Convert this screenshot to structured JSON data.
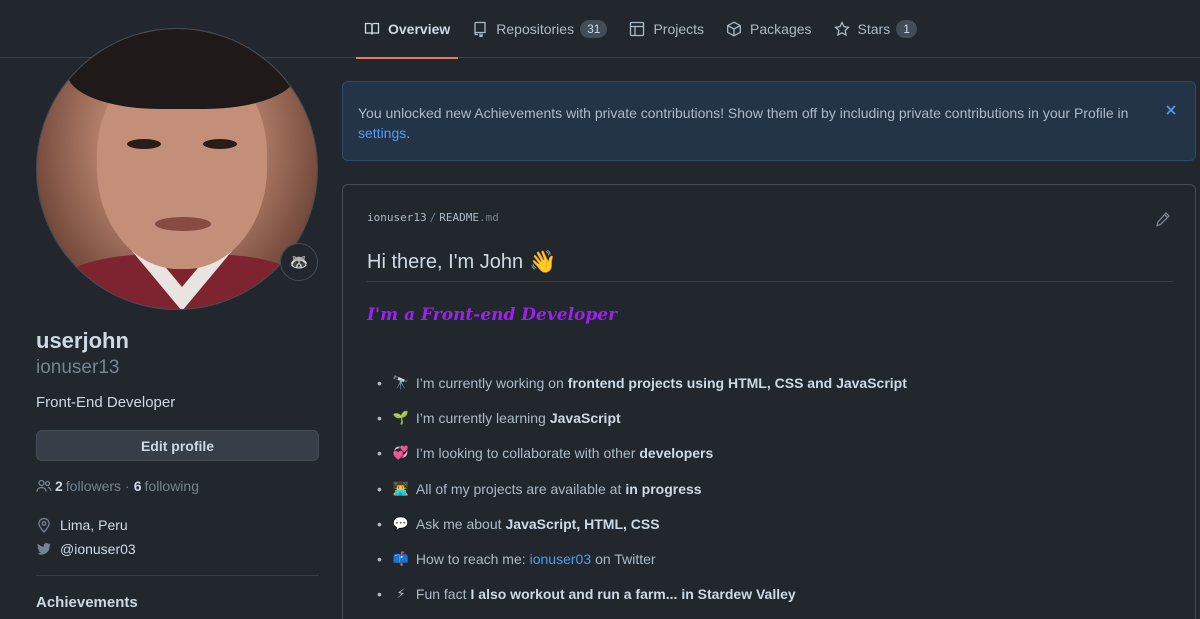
{
  "tabs": [
    {
      "label": "Overview",
      "icon": "book-icon",
      "active": true
    },
    {
      "label": "Repositories",
      "icon": "repo-icon",
      "count": "31"
    },
    {
      "label": "Projects",
      "icon": "table-icon"
    },
    {
      "label": "Packages",
      "icon": "package-icon"
    },
    {
      "label": "Stars",
      "icon": "star-icon",
      "count": "1"
    }
  ],
  "profile": {
    "full_name": "userjohn",
    "username": "ionuser13",
    "bio": "Front-End Developer",
    "edit_label": "Edit profile",
    "followers_count": "2",
    "followers_label": "followers",
    "dot": "·",
    "following_count": "6",
    "following_label": "following",
    "location": "Lima, Peru",
    "twitter": "@ionuser03",
    "status_emoji": "🦝",
    "achievements_title": "Achievements"
  },
  "flash": {
    "text": "You unlocked new Achievements with private contributions! Show them off by including private contributions in your Profile in ",
    "link": "settings",
    "end": "."
  },
  "readme": {
    "owner": "ionuser13",
    "separator": "/",
    "file": "README",
    "ext": ".md",
    "heading": "Hi there, I'm John",
    "heading_emoji": "👋",
    "subtitle": "I'm a Front-end Developer",
    "items": [
      {
        "emoji": "🔭",
        "text": "I’m currently working on",
        "bold": "frontend projects using HTML, CSS and JavaScript"
      },
      {
        "emoji": "🌱",
        "text": "I’m currently learning",
        "bold": "JavaScript"
      },
      {
        "emoji": "💞️",
        "text": "I’m looking to collaborate with other",
        "bold": "developers"
      },
      {
        "emoji": "👨‍💻",
        "text": "All of my projects are available at",
        "bold": "in progress"
      },
      {
        "emoji": "💬",
        "text": "Ask me about",
        "bold": "JavaScript, HTML, CSS"
      },
      {
        "emoji": "📫",
        "text": "How to reach me:",
        "link": "ionuser03",
        "after": "on Twitter"
      },
      {
        "emoji": "⚡",
        "text": "Fun fact",
        "bold": "I also workout and run a farm... in Stardew Valley"
      }
    ]
  },
  "colors": {
    "background": "#22272e",
    "accent_underline": "#ec775c",
    "link": "#539bf5",
    "subtitle": "#a020f0"
  }
}
